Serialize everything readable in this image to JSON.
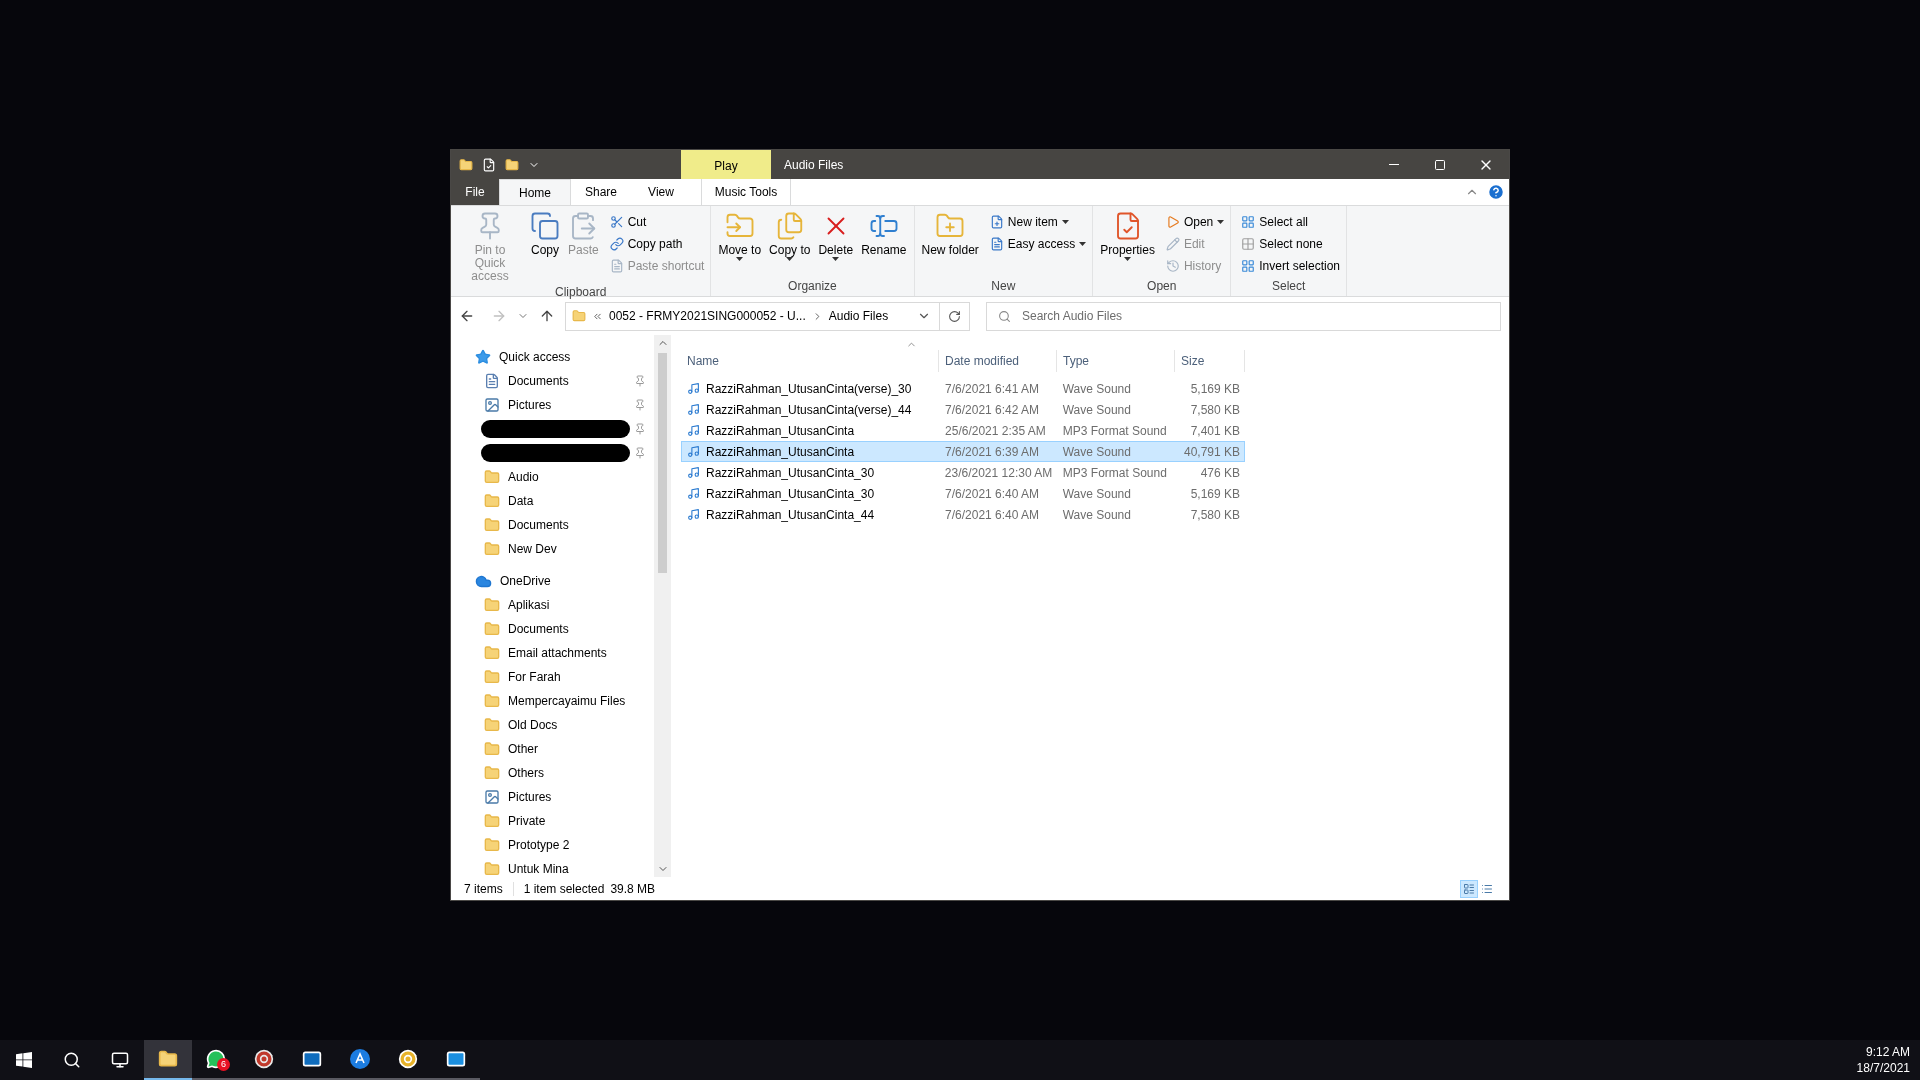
{
  "window": {
    "title": "Audio Files",
    "contextual_tab": "Play"
  },
  "ribbon_tabs": [
    {
      "label": "File",
      "kind": "file",
      "selected": false
    },
    {
      "label": "Home",
      "kind": "normal",
      "selected": true
    },
    {
      "label": "Share",
      "kind": "normal",
      "selected": false
    },
    {
      "label": "View",
      "kind": "normal",
      "selected": false
    },
    {
      "label": "Music Tools",
      "kind": "contextual",
      "selected": false
    }
  ],
  "ribbon_groups": [
    {
      "label": "Clipboard",
      "items": [
        {
          "kind": "large",
          "label": "Pin to Quick access",
          "disabled": true,
          "dropdown": false
        },
        {
          "kind": "large",
          "label": "Copy",
          "disabled": false,
          "dropdown": false
        },
        {
          "kind": "large",
          "label": "Paste",
          "disabled": true,
          "dropdown": false
        },
        {
          "kind": "small",
          "label": "Cut",
          "disabled": false,
          "dropdown": false
        },
        {
          "kind": "small",
          "label": "Copy path",
          "disabled": false,
          "dropdown": false
        },
        {
          "kind": "small",
          "label": "Paste shortcut",
          "disabled": true,
          "dropdown": false
        }
      ]
    },
    {
      "label": "Organize",
      "items": [
        {
          "kind": "large",
          "label": "Move to",
          "disabled": false,
          "dropdown": true
        },
        {
          "kind": "large",
          "label": "Copy to",
          "disabled": false,
          "dropdown": true
        },
        {
          "kind": "large",
          "label": "Delete",
          "disabled": false,
          "dropdown": true
        },
        {
          "kind": "large",
          "label": "Rename",
          "disabled": false,
          "dropdown": false
        }
      ]
    },
    {
      "label": "New",
      "items": [
        {
          "kind": "large",
          "label": "New folder",
          "disabled": false,
          "dropdown": false
        },
        {
          "kind": "small",
          "label": "New item",
          "disabled": false,
          "dropdown": true
        },
        {
          "kind": "small",
          "label": "Easy access",
          "disabled": false,
          "dropdown": true
        }
      ]
    },
    {
      "label": "Open",
      "items": [
        {
          "kind": "large",
          "label": "Properties",
          "disabled": false,
          "dropdown": true
        },
        {
          "kind": "small",
          "label": "Open",
          "disabled": false,
          "dropdown": true
        },
        {
          "kind": "small",
          "label": "Edit",
          "disabled": true,
          "dropdown": false
        },
        {
          "kind": "small",
          "label": "History",
          "disabled": true,
          "dropdown": false
        }
      ]
    },
    {
      "label": "Select",
      "items": [
        {
          "kind": "small",
          "label": "Select all",
          "disabled": false,
          "dropdown": false
        },
        {
          "kind": "small",
          "label": "Select none",
          "disabled": false,
          "dropdown": false
        },
        {
          "kind": "small",
          "label": "Invert selection",
          "disabled": false,
          "dropdown": false
        }
      ]
    }
  ],
  "address_bar": {
    "parent": "0052 - FRMY2021SING000052 - U...",
    "current": "Audio Files"
  },
  "search": {
    "placeholder": "Search Audio Files"
  },
  "navigation": [
    {
      "label": "Quick access",
      "kind": "quick_access",
      "children": [
        {
          "label": "Documents",
          "kind": "documents",
          "pinned": true
        },
        {
          "label": "Pictures",
          "kind": "pictures",
          "pinned": true
        },
        {
          "kind": "redacted",
          "pinned": true
        },
        {
          "kind": "redacted",
          "pinned": true
        },
        {
          "label": "Audio",
          "kind": "folder",
          "pinned": false
        },
        {
          "label": "Data",
          "kind": "folder",
          "pinned": false
        },
        {
          "label": "Documents",
          "kind": "folder",
          "pinned": false
        },
        {
          "label": "New Dev",
          "kind": "folder",
          "pinned": false
        }
      ]
    },
    {
      "label": "OneDrive",
      "kind": "onedrive",
      "children": [
        {
          "label": "Aplikasi",
          "kind": "folder",
          "pinned": false
        },
        {
          "label": "Documents",
          "kind": "folder",
          "pinned": false
        },
        {
          "label": "Email attachments",
          "kind": "folder",
          "pinned": false
        },
        {
          "label": "For Farah",
          "kind": "folder",
          "pinned": false
        },
        {
          "label": "Mempercayaimu Files",
          "kind": "folder",
          "pinned": false
        },
        {
          "label": "Old Docs",
          "kind": "folder",
          "pinned": false
        },
        {
          "label": "Other",
          "kind": "folder",
          "pinned": false
        },
        {
          "label": "Others",
          "kind": "folder",
          "pinned": false
        },
        {
          "label": "Pictures",
          "kind": "pictures",
          "pinned": false
        },
        {
          "label": "Private",
          "kind": "folder",
          "pinned": false
        },
        {
          "label": "Prototype 2",
          "kind": "folder",
          "pinned": false
        },
        {
          "label": "Untuk Mina",
          "kind": "folder",
          "pinned": false
        }
      ]
    }
  ],
  "table": {
    "columns": [
      "Name",
      "Date modified",
      "Type",
      "Size"
    ],
    "rows": [
      {
        "name": "RazziRahman_UtusanCinta(verse)_30",
        "date": "7/6/2021 6:41 AM",
        "type": "Wave Sound",
        "size": "5,169 KB",
        "selected": false
      },
      {
        "name": "RazziRahman_UtusanCinta(verse)_44",
        "date": "7/6/2021 6:42 AM",
        "type": "Wave Sound",
        "size": "7,580 KB",
        "selected": false
      },
      {
        "name": "RazziRahman_UtusanCinta",
        "date": "25/6/2021 2:35 AM",
        "type": "MP3 Format Sound",
        "size": "7,401 KB",
        "selected": false
      },
      {
        "name": "RazziRahman_UtusanCinta",
        "date": "7/6/2021 6:39 AM",
        "type": "Wave Sound",
        "size": "40,791 KB",
        "selected": true
      },
      {
        "name": "RazziRahman_UtusanCinta_30",
        "date": "23/6/2021 12:30 AM",
        "type": "MP3 Format Sound",
        "size": "476 KB",
        "selected": false
      },
      {
        "name": "RazziRahman_UtusanCinta_30",
        "date": "7/6/2021 6:40 AM",
        "type": "Wave Sound",
        "size": "5,169 KB",
        "selected": false
      },
      {
        "name": "RazziRahman_UtusanCinta_44",
        "date": "7/6/2021 6:40 AM",
        "type": "Wave Sound",
        "size": "7,580 KB",
        "selected": false
      }
    ]
  },
  "status_bar": {
    "count": "7 items",
    "selection": "1 item selected",
    "selection_size": "39.8 MB",
    "views": [
      {
        "kind": "details",
        "selected": true
      },
      {
        "kind": "large_icons",
        "selected": false
      }
    ]
  },
  "taskbar": {
    "items": [
      {
        "kind": "start",
        "active": false
      },
      {
        "kind": "search",
        "active": false
      },
      {
        "kind": "task_view",
        "active": false
      },
      {
        "kind": "app",
        "active": true
      },
      {
        "kind": "app",
        "active": false,
        "badge": "6"
      },
      {
        "kind": "app",
        "active": false
      },
      {
        "kind": "app",
        "active": false
      },
      {
        "kind": "app",
        "active": false
      },
      {
        "kind": "app",
        "active": false
      },
      {
        "kind": "app",
        "active": false
      }
    ],
    "time": "9:12 AM",
    "date": "18/7/2021"
  }
}
